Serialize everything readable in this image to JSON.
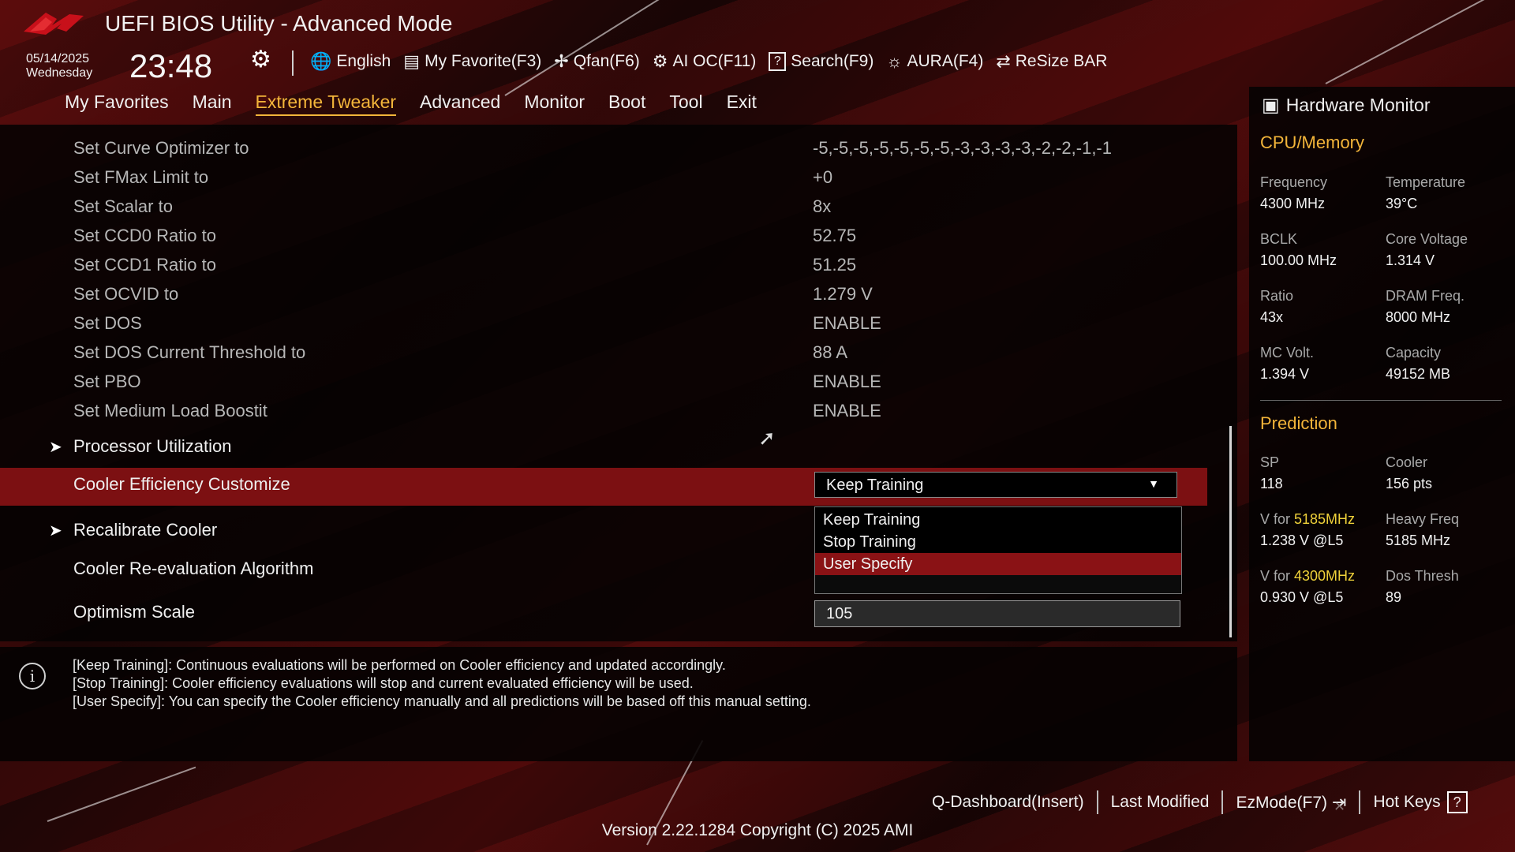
{
  "window": {
    "title": "UEFI BIOS Utility - Advanced Mode"
  },
  "datetime": {
    "date": "05/14/2025",
    "day": "Wednesday",
    "time": "23:48"
  },
  "toolbar": [
    {
      "label": "English",
      "icon": "globe-icon",
      "glyph": "🌐"
    },
    {
      "label": "My Favorite(F3)",
      "icon": "favorite-list-icon",
      "glyph": "▤"
    },
    {
      "label": "Qfan(F6)",
      "icon": "fan-icon",
      "glyph": "✢"
    },
    {
      "label": "AI OC(F11)",
      "icon": "ai-chip-icon",
      "glyph": "⚙"
    },
    {
      "label": "Search(F9)",
      "icon": "search-help-icon",
      "glyph": "?"
    },
    {
      "label": "AURA(F4)",
      "icon": "aura-light-icon",
      "glyph": "☼"
    },
    {
      "label": "ReSize BAR",
      "icon": "resize-bar-icon",
      "glyph": "⇄"
    }
  ],
  "tabs": [
    {
      "label": "My Favorites",
      "active": false
    },
    {
      "label": "Main",
      "active": false
    },
    {
      "label": "Extreme Tweaker",
      "active": true
    },
    {
      "label": "Advanced",
      "active": false
    },
    {
      "label": "Monitor",
      "active": false
    },
    {
      "label": "Boot",
      "active": false
    },
    {
      "label": "Tool",
      "active": false
    },
    {
      "label": "Exit",
      "active": false
    }
  ],
  "settings": [
    {
      "label": "Set Curve Optimizer to",
      "value": "-5,-5,-5,-5,-5,-5,-5,-3,-3,-3,-3,-2,-2,-1,-1"
    },
    {
      "label": "Set FMax Limit to",
      "value": "+0"
    },
    {
      "label": "Set Scalar to",
      "value": "8x"
    },
    {
      "label": "Set CCD0 Ratio to",
      "value": "52.75"
    },
    {
      "label": "Set CCD1 Ratio to",
      "value": "51.25"
    },
    {
      "label": "Set OCVID to",
      "value": "1.279 V"
    },
    {
      "label": "Set DOS",
      "value": "ENABLE"
    },
    {
      "label": "Set DOS Current Threshold to",
      "value": "88 A"
    },
    {
      "label": "Set PBO",
      "value": "ENABLE"
    },
    {
      "label": "Set Medium Load Boostit",
      "value": "ENABLE"
    }
  ],
  "submenus": {
    "processor_utilization": "Processor Utilization",
    "recalibrate_cooler": "Recalibrate Cooler"
  },
  "cooler_efficiency": {
    "label": "Cooler Efficiency Customize",
    "value": "Keep Training",
    "options": [
      "Keep Training",
      "Stop Training",
      "User Specify"
    ],
    "highlighted_option": "User Specify"
  },
  "reevaluation": {
    "label": "Cooler Re-evaluation Algorithm"
  },
  "optimism": {
    "label": "Optimism Scale",
    "value": "105"
  },
  "help": {
    "lines": [
      "[Keep Training]: Continuous evaluations will be performed on Cooler efficiency and updated accordingly.",
      "[Stop Training]: Cooler efficiency evaluations will stop and current evaluated efficiency will be used.",
      "[User Specify]: You can specify the Cooler efficiency manually and all predictions will be based off this manual setting."
    ]
  },
  "hardware_monitor": {
    "title": "Hardware Monitor",
    "cpu_memory_title": "CPU/Memory",
    "cpu_memory": [
      {
        "key": "Frequency",
        "value": "4300 MHz"
      },
      {
        "key": "Temperature",
        "value": "39°C"
      },
      {
        "key": "BCLK",
        "value": "100.00 MHz"
      },
      {
        "key": "Core Voltage",
        "value": "1.314 V"
      },
      {
        "key": "Ratio",
        "value": "43x"
      },
      {
        "key": "DRAM Freq.",
        "value": "8000 MHz"
      },
      {
        "key": "MC Volt.",
        "value": "1.394 V"
      },
      {
        "key": "Capacity",
        "value": "49152 MB"
      }
    ],
    "prediction_title": "Prediction",
    "prediction": {
      "sp_key": "SP",
      "sp_value": "118",
      "cooler_key": "Cooler",
      "cooler_value": "156 pts",
      "v1_prefix": "V for ",
      "v1_freq": "5185MHz",
      "v1_value": "1.238 V @L5",
      "heavy_key": "Heavy Freq",
      "heavy_value": "5185 MHz",
      "v2_prefix": "V for ",
      "v2_freq": "4300MHz",
      "v2_value": "0.930 V @L5",
      "dos_key": "Dos Thresh",
      "dos_value": "89"
    }
  },
  "bottom": {
    "q_dashboard": "Q-Dashboard(Insert)",
    "last_modified": "Last Modified",
    "ezmode": "EzMode(F7)",
    "hotkeys": "Hot Keys",
    "version": "Version 2.22.1284 Copyright (C) 2025 AMI"
  },
  "colors": {
    "accent": "#f3b53a",
    "highlight": "#7c1012",
    "option_selected": "#8a1215"
  }
}
